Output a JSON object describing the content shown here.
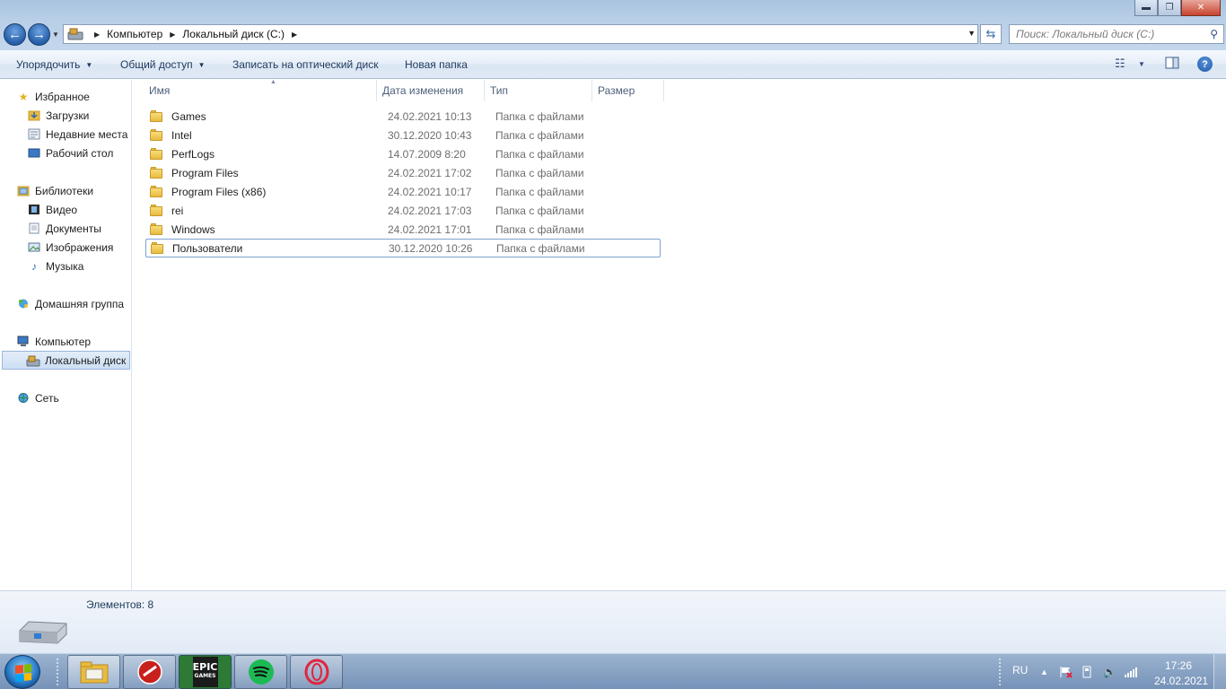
{
  "window": {
    "minimize": "▬",
    "maximize": "❐",
    "close": "✕"
  },
  "address": {
    "crumbs": [
      "Компьютер",
      "Локальный диск (C:)"
    ],
    "search_placeholder": "Поиск: Локальный диск (C:)"
  },
  "toolbar": {
    "organize": "Упорядочить",
    "share": "Общий доступ",
    "burn": "Записать на оптический диск",
    "new_folder": "Новая папка"
  },
  "nav": {
    "favorites": "Избранное",
    "downloads": "Загрузки",
    "recent": "Недавние места",
    "desktop": "Рабочий стол",
    "libraries": "Библиотеки",
    "video": "Видео",
    "documents": "Документы",
    "images": "Изображения",
    "music": "Музыка",
    "homegroup": "Домашняя группа",
    "computer": "Компьютер",
    "local_disk": "Локальный диск",
    "network": "Сеть"
  },
  "columns": {
    "name": "Имя",
    "date": "Дата изменения",
    "type": "Тип",
    "size": "Размер"
  },
  "files": [
    {
      "name": "Games",
      "date": "24.02.2021 10:13",
      "type": "Папка с файлами"
    },
    {
      "name": "Intel",
      "date": "30.12.2020 10:43",
      "type": "Папка с файлами"
    },
    {
      "name": "PerfLogs",
      "date": "14.07.2009 8:20",
      "type": "Папка с файлами"
    },
    {
      "name": "Program Files",
      "date": "24.02.2021 17:02",
      "type": "Папка с файлами"
    },
    {
      "name": "Program Files (x86)",
      "date": "24.02.2021 10:17",
      "type": "Папка с файлами"
    },
    {
      "name": "rei",
      "date": "24.02.2021 17:03",
      "type": "Папка с файлами"
    },
    {
      "name": "Windows",
      "date": "24.02.2021 17:01",
      "type": "Папка с файлами"
    },
    {
      "name": "Пользователи",
      "date": "30.12.2020 10:26",
      "type": "Папка с файлами"
    }
  ],
  "details": {
    "item_count": "Элементов: 8"
  },
  "taskbar": {
    "apps": [
      "file-explorer",
      "world-of-tanks",
      "epic-games",
      "spotify",
      "opera-gx"
    ],
    "epic_label": "EPIC",
    "epic_sub": "GAMES",
    "language": "RU",
    "time": "17:26",
    "date": "24.02.2021"
  }
}
